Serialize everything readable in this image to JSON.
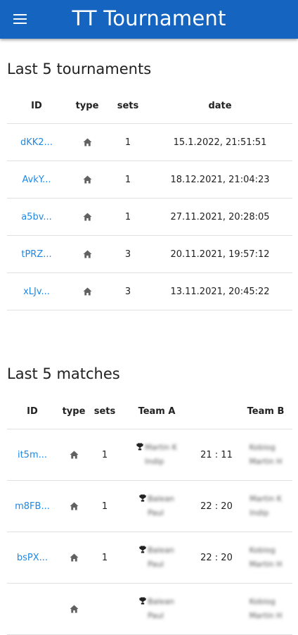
{
  "appbar": {
    "title": "TT Tournament",
    "menu_icon": "menu-icon"
  },
  "tournaments": {
    "heading": "Last 5 tournaments",
    "columns": [
      "ID",
      "type",
      "sets",
      "date"
    ],
    "rows": [
      {
        "id": "dKK2...",
        "type_icon": "home-icon",
        "sets": "1",
        "date": "15.1.2022, 21:51:51"
      },
      {
        "id": "AvkY...",
        "type_icon": "home-icon",
        "sets": "1",
        "date": "18.12.2021, 21:04:23"
      },
      {
        "id": "a5bv...",
        "type_icon": "home-icon",
        "sets": "1",
        "date": "27.11.2021, 20:28:05"
      },
      {
        "id": "tPRZ...",
        "type_icon": "home-icon",
        "sets": "3",
        "date": "20.11.2021, 19:57:12"
      },
      {
        "id": "xLJv...",
        "type_icon": "home-icon",
        "sets": "3",
        "date": "13.11.2021, 20:45:22"
      }
    ]
  },
  "matches": {
    "heading": "Last 5 matches",
    "columns": [
      "ID",
      "type",
      "sets",
      "Team A",
      "",
      "Team B"
    ],
    "rows": [
      {
        "id": "it5m...",
        "type_icon": "home-icon",
        "sets": "1",
        "team_a": [
          "Martin K",
          "Indip"
        ],
        "winner": "A",
        "score": "21 : 11",
        "team_b": [
          "Kobiog",
          "Martin H"
        ]
      },
      {
        "id": "m8FB...",
        "type_icon": "home-icon",
        "sets": "1",
        "team_a": [
          "Balean",
          "Paul"
        ],
        "winner": "A",
        "score": "22 : 20",
        "team_b": [
          "Martin K",
          "Indip"
        ]
      },
      {
        "id": "bsPX...",
        "type_icon": "home-icon",
        "sets": "1",
        "team_a": [
          "Balean",
          "Paul"
        ],
        "winner": "A",
        "score": "22 : 20",
        "team_b": [
          "Kobiog",
          "Martin H"
        ]
      },
      {
        "id": "",
        "type_icon": "home-icon",
        "sets": "",
        "team_a": [
          "Balean",
          "Paul"
        ],
        "winner": "A",
        "score": "",
        "team_b": [
          "Kobiog",
          "Martin H"
        ]
      }
    ]
  },
  "colors": {
    "appbar": "#1565c0",
    "link": "#1e88e5",
    "icon": "#616161",
    "divider": "#e0e0e0"
  }
}
